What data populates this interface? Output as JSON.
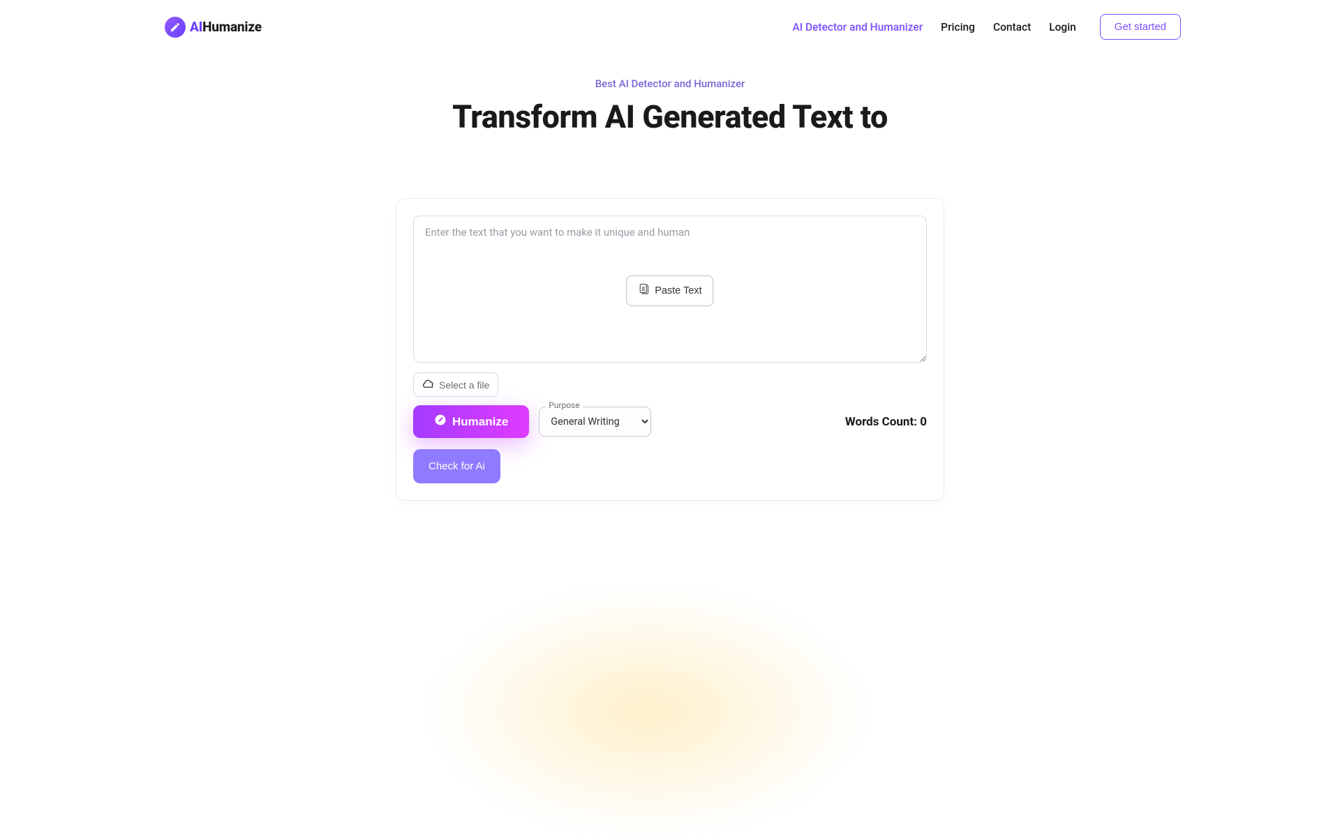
{
  "logo": {
    "ai": "AI",
    "rest": "Humanize"
  },
  "nav": {
    "detector": "AI Detector and Humanizer",
    "pricing": "Pricing",
    "contact": "Contact",
    "login": "Login",
    "get_started": "Get started"
  },
  "hero": {
    "eyebrow": "Best AI Detector and Humanizer",
    "title": "Transform AI Generated Text to"
  },
  "editor": {
    "placeholder": "Enter the text that you want to make it unique and human",
    "paste_label": "Paste Text",
    "select_file": "Select a file",
    "humanize": "Humanize",
    "purpose_label": "Purpose",
    "purpose_value": "General Writing",
    "word_count_label": "Words Count: ",
    "word_count_value": "0",
    "check_ai": "Check for Ai"
  }
}
